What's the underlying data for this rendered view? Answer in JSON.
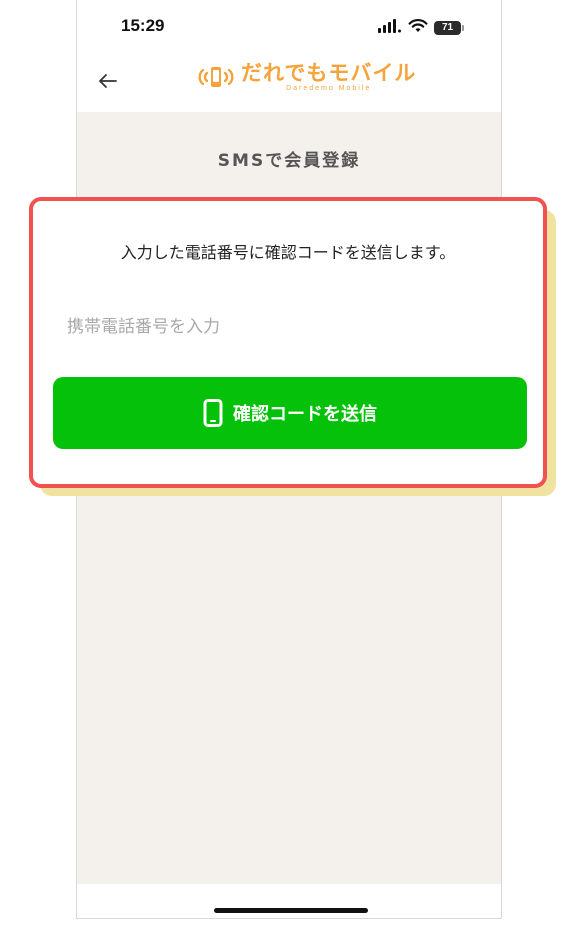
{
  "status_bar": {
    "time": "15:29",
    "battery": "71"
  },
  "header": {
    "logo_text": "だれでもモバイル",
    "logo_subtext": "Daredemo Mobile"
  },
  "page": {
    "title": "SMSで会員登録"
  },
  "form": {
    "description": "入力した電話番号に確認コードを送信します。",
    "phone_placeholder": "携帯電話番号を入力",
    "phone_value": "",
    "send_button_label": "確認コードを送信"
  },
  "colors": {
    "accent_green": "#06c10a",
    "highlight_red": "#ef5250",
    "logo_orange": "#f5a33a",
    "background": "#f4f1ec"
  }
}
